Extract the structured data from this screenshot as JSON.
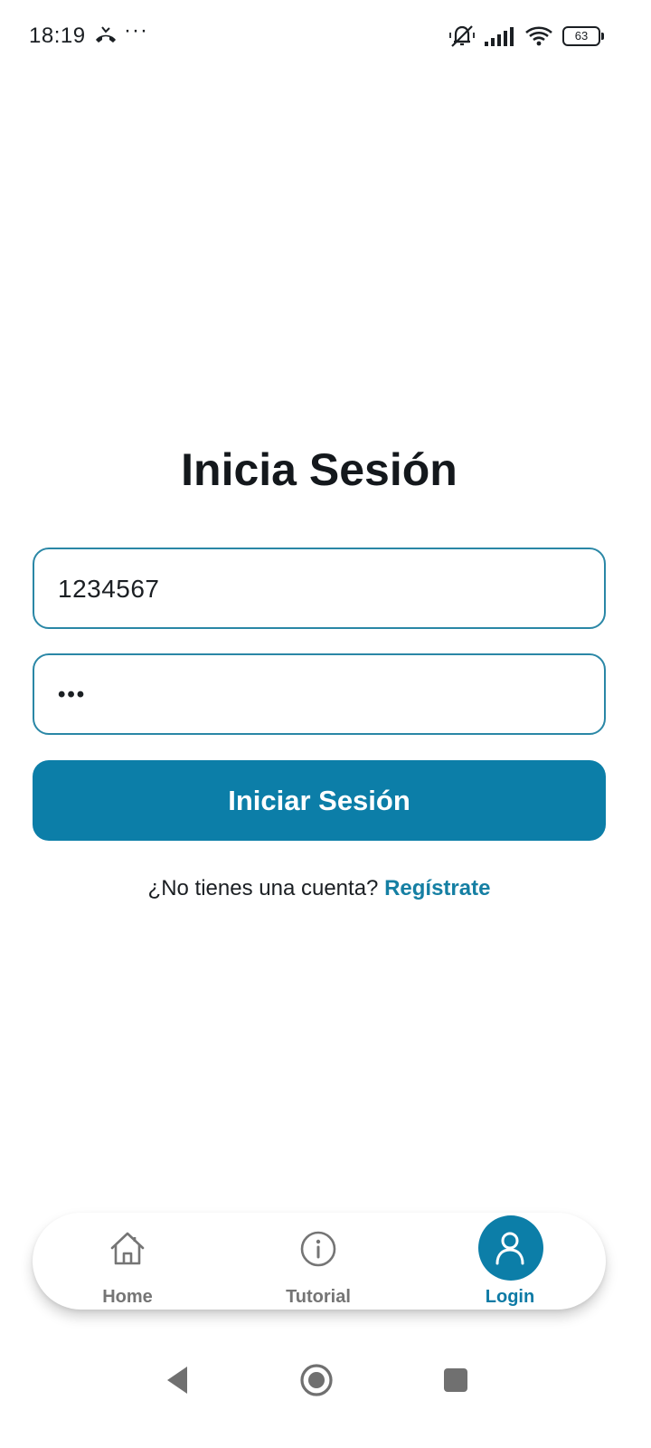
{
  "status_bar": {
    "time": "18:19",
    "more": "···",
    "battery": "63",
    "icons": [
      "missed-call-icon",
      "mute-icon",
      "signal-icon",
      "wifi-icon",
      "battery-icon"
    ]
  },
  "login": {
    "title": "Inicia Sesión",
    "username_value": "1234567",
    "password_value": "•••",
    "submit_label": "Iniciar Sesión",
    "register_prompt": "¿No tienes una cuenta?",
    "register_link": "Regístrate"
  },
  "bottom_nav": {
    "items": [
      {
        "label": "Home",
        "icon": "home-icon",
        "active": false
      },
      {
        "label": "Tutorial",
        "icon": "info-icon",
        "active": false
      },
      {
        "label": "Login",
        "icon": "user-icon",
        "active": true
      }
    ]
  },
  "colors": {
    "primary": "#0c7ea8",
    "field_border": "#2a87a6",
    "inactive_nav": "#757575",
    "text": "#1b1f23"
  }
}
